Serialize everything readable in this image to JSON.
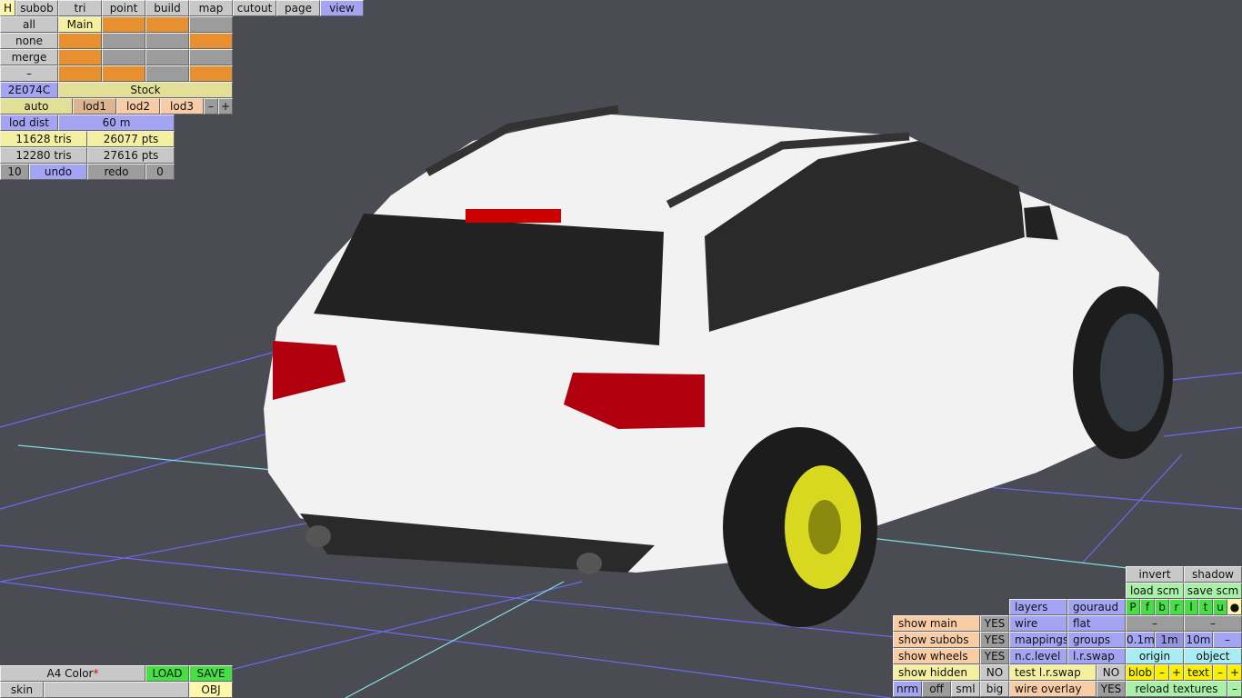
{
  "top_tabs": [
    "H",
    "subob",
    "tri",
    "point",
    "build",
    "map",
    "cutout",
    "page",
    "view"
  ],
  "subob": {
    "rows": [
      "all",
      "none",
      "merge",
      "–"
    ],
    "main": "Main",
    "color_code": "2E074C",
    "stock": "Stock"
  },
  "lod": {
    "auto": "auto",
    "lod1": "lod1",
    "lod2": "lod2",
    "lod3": "lod3",
    "minus": "–",
    "plus": "+",
    "dist_label": "lod dist",
    "dist_value": "60 m"
  },
  "stats": {
    "tris1": "11628 tris",
    "pts1": "26077 pts",
    "tris2": "12280 tris",
    "pts2": "27616 pts"
  },
  "history": {
    "undo_count": "10",
    "undo": "undo",
    "redo": "redo",
    "redo_count": "0"
  },
  "skin": {
    "name": "A4 Color",
    "modified": "*",
    "load": "LOAD",
    "save": "SAVE",
    "skin": "skin",
    "path": "",
    "obj": "OBJ"
  },
  "view": {
    "invert": "invert",
    "shadow": "shadow",
    "load_scm": "load scm",
    "save_scm": "save scm",
    "layers": "layers",
    "gouraud": "gouraud",
    "wire": "wire",
    "flat": "flat",
    "mappings": "mappings",
    "groups": "groups",
    "nclevel": "n.c.level",
    "lrswap": "l.r.swap",
    "letters": [
      "P",
      "f",
      "b",
      "r",
      "l",
      "t",
      "u",
      "●"
    ],
    "dash": "–",
    "grid": [
      "0.1m",
      "1m",
      "10m",
      "–"
    ],
    "origin": "origin",
    "object": "object",
    "blob": "blob",
    "text": "text",
    "minus": "–",
    "plus": "+",
    "reload": "reload textures",
    "show_main": "show main",
    "show_subobs": "show subobs",
    "show_wheels": "show wheels",
    "show_hidden": "show hidden",
    "yes": "YES",
    "no": "NO",
    "test_lrswap": "test l.r.swap",
    "wire_overlay": "wire overlay",
    "sizes": [
      "nrm",
      "off",
      "sml",
      "big"
    ]
  }
}
